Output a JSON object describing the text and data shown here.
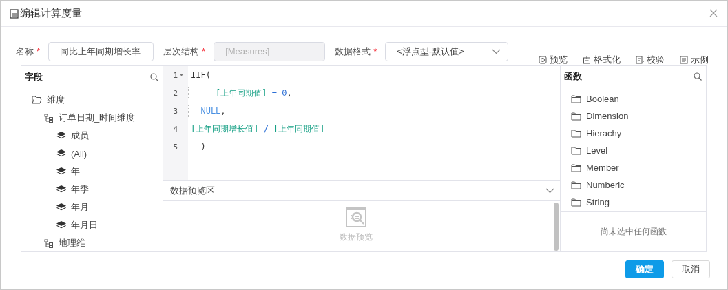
{
  "window": {
    "title": "编辑计算度量"
  },
  "form": {
    "name": {
      "label": "名称",
      "required_mark": "*",
      "value": "同比上年同期增长率"
    },
    "hierarchy": {
      "label": "层次结构",
      "required_mark": "*",
      "value": "[Measures]",
      "disabled": true
    },
    "format": {
      "label": "数据格式",
      "required_mark": "*",
      "value": "<浮点型-默认值>"
    }
  },
  "toolbar": [
    {
      "kind": "preview",
      "label": "预览"
    },
    {
      "kind": "format",
      "label": "格式化"
    },
    {
      "kind": "validate",
      "label": "校验"
    },
    {
      "kind": "example",
      "label": "示例"
    }
  ],
  "fields": {
    "title": "字段",
    "tree": [
      {
        "kind": "folder",
        "label": "维度",
        "children": [
          {
            "kind": "hierarchy",
            "label": "订单日期_时间维度",
            "children": [
              {
                "kind": "level",
                "label": "成员"
              },
              {
                "kind": "level",
                "label": "(All)"
              },
              {
                "kind": "level",
                "label": "年"
              },
              {
                "kind": "level",
                "label": "年季"
              },
              {
                "kind": "level",
                "label": "年月"
              },
              {
                "kind": "level",
                "label": "年月日"
              }
            ]
          },
          {
            "kind": "hierarchy",
            "label": "地理维"
          }
        ]
      }
    ]
  },
  "editor": {
    "lines": [
      {
        "number": "1",
        "fold": true,
        "tokens": [
          {
            "kind": "plain",
            "text": "IIF("
          }
        ]
      },
      {
        "number": "2",
        "guide": true,
        "tokens": [
          {
            "kind": "field",
            "text": "     [上年同期值]"
          },
          {
            "kind": "op",
            "text": " = "
          },
          {
            "kind": "number",
            "text": "0"
          },
          {
            "kind": "plain",
            "text": ","
          }
        ]
      },
      {
        "number": "3",
        "guide": true,
        "tokens": [
          {
            "kind": "keyword",
            "text": "  NULL"
          },
          {
            "kind": "plain",
            "text": ","
          }
        ]
      },
      {
        "number": "4",
        "guide": false,
        "tokens": [
          {
            "kind": "field",
            "text": "[上年同期增长值]"
          },
          {
            "kind": "op",
            "text": " / "
          },
          {
            "kind": "field",
            "text": "[上年同期值]"
          }
        ]
      },
      {
        "number": "5",
        "guide": false,
        "tokens": [
          {
            "kind": "plain",
            "text": "  )"
          }
        ]
      }
    ]
  },
  "preview": {
    "title": "数据预览区",
    "expanded": true,
    "empty_text": "数据预览"
  },
  "functions": {
    "title": "函数",
    "items": [
      "Boolean",
      "Dimension",
      "Hierachy",
      "Level",
      "Member",
      "Numberic",
      "String"
    ],
    "empty_text": "尚未选中任何函数"
  },
  "buttons": [
    {
      "kind": "primary",
      "label": "确定"
    },
    {
      "kind": "default",
      "label": "取消"
    }
  ]
}
